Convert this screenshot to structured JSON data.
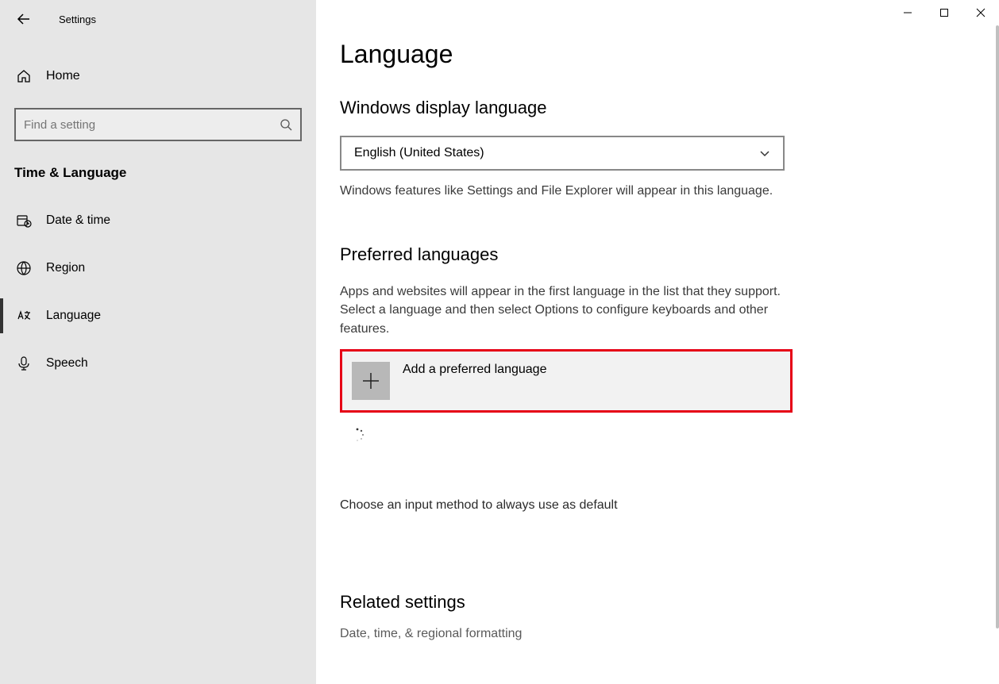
{
  "app_title": "Settings",
  "home_label": "Home",
  "search_placeholder": "Find a setting",
  "section_title": "Time & Language",
  "nav": [
    {
      "label": "Date & time"
    },
    {
      "label": "Region"
    },
    {
      "label": "Language"
    },
    {
      "label": "Speech"
    }
  ],
  "page_title": "Language",
  "display_lang": {
    "heading": "Windows display language",
    "selected": "English (United States)",
    "desc": "Windows features like Settings and File Explorer will appear in this language."
  },
  "preferred": {
    "heading": "Preferred languages",
    "desc": "Apps and websites will appear in the first language in the list that they support. Select a language and then select Options to configure keyboards and other features.",
    "add_label": "Add a preferred language"
  },
  "input_default": "Choose an input method to always use as default",
  "related": {
    "heading": "Related settings",
    "item1": "Date, time, & regional formatting"
  }
}
